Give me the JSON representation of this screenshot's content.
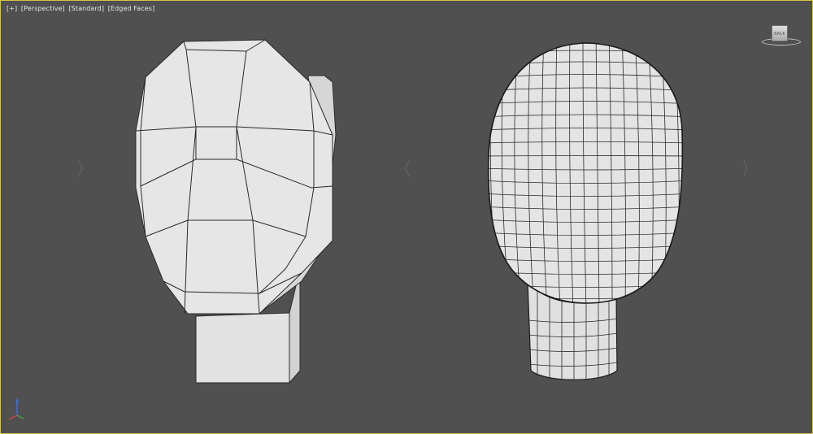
{
  "viewport": {
    "label_plus": "[+]",
    "label_view": "[Perspective]",
    "label_shading": "[Standard]",
    "label_edges": "[Edged Faces]",
    "border_color": "#d8c24a",
    "background_color": "#505050"
  },
  "viewcube": {
    "face_label": "BACK"
  },
  "objects": [
    {
      "name": "low-poly head",
      "shape": "head-with-neck",
      "mesh": "low-poly",
      "color": "#e4e4e4"
    },
    {
      "name": "subdivided head",
      "shape": "head-with-neck",
      "mesh": "subdivided",
      "color": "#e2e2e2"
    }
  ],
  "axis_gizmo": {
    "colors": {
      "x": "#c84a3a",
      "y": "#4aa34a",
      "z": "#3f6fd6"
    }
  }
}
